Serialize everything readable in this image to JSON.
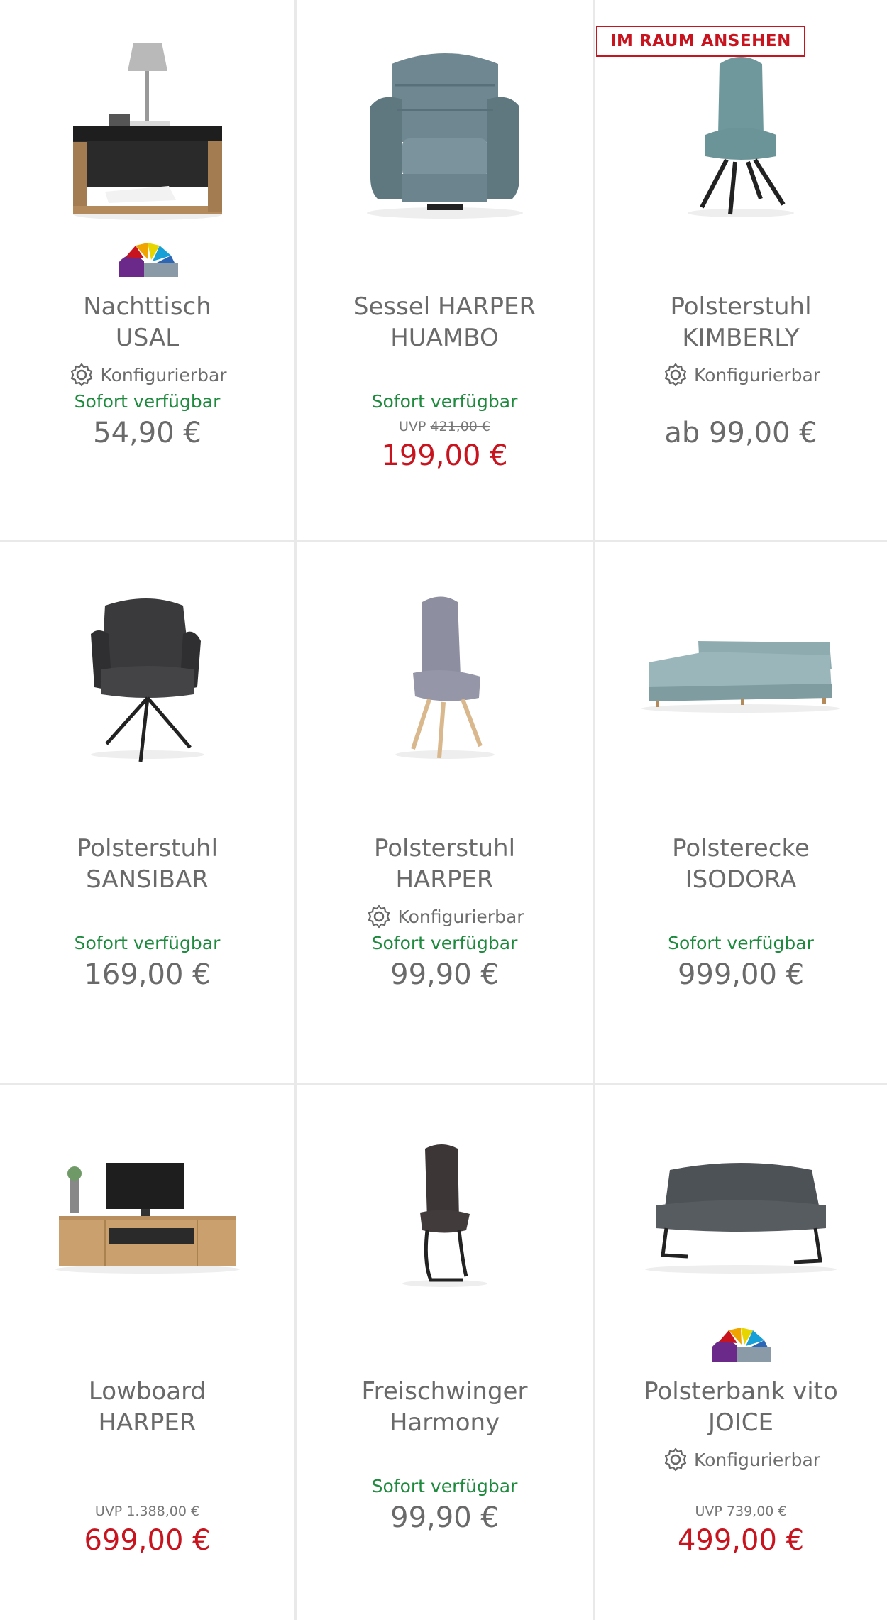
{
  "badge_label": "IM RAUM ANSEHEN",
  "config_label": "Konfigurierbar",
  "available_label": "Sofort verfügbar",
  "uvp_label": "UVP",
  "colors": {
    "available": "#1d8a3d",
    "sale": "#c8141e",
    "text": "#6a6a6a"
  },
  "products": [
    {
      "title_line1": "Nachttisch",
      "title_line2": "USAL",
      "configurable": true,
      "available": true,
      "uvp": "",
      "price": "54,90 €",
      "energy_icon": true,
      "image_icon": "nightstand-image"
    },
    {
      "title_line1": "Sessel HARPER",
      "title_line2": "HUAMBO",
      "configurable": false,
      "available": true,
      "uvp": "421,00 €",
      "price": "199,00 €",
      "energy_icon": false,
      "image_icon": "recliner-image"
    },
    {
      "title_line1": "Polsterstuhl",
      "title_line2": "KIMBERLY",
      "configurable": true,
      "available": false,
      "uvp": "",
      "price": "ab 99,00 €",
      "energy_icon": false,
      "image_icon": "chair-image",
      "badge": true
    },
    {
      "title_line1": "Polsterstuhl",
      "title_line2": "SANSIBAR",
      "configurable": false,
      "available": true,
      "uvp": "",
      "price": "169,00 €",
      "energy_icon": false,
      "image_icon": "armchair-swivel-image"
    },
    {
      "title_line1": "Polsterstuhl",
      "title_line2": "HARPER",
      "configurable": true,
      "available": true,
      "uvp": "",
      "price": "99,90 €",
      "energy_icon": false,
      "image_icon": "grey-chair-image"
    },
    {
      "title_line1": "Polsterecke",
      "title_line2": "ISODORA",
      "configurable": false,
      "available": true,
      "uvp": "",
      "price": "999,00 €",
      "energy_icon": false,
      "image_icon": "corner-sofa-image"
    },
    {
      "title_line1": "Lowboard",
      "title_line2": "HARPER",
      "configurable": false,
      "available": false,
      "uvp": "1.388,00 €",
      "price": "699,00 €",
      "energy_icon": false,
      "image_icon": "lowboard-image"
    },
    {
      "title_line1": "Freischwinger",
      "title_line2": "Harmony",
      "configurable": false,
      "available": true,
      "uvp": "",
      "price": "99,90 €",
      "energy_icon": false,
      "image_icon": "cantilever-chair-image"
    },
    {
      "title_line1": "Polsterbank vito",
      "title_line2": "JOICE",
      "configurable": true,
      "available": false,
      "uvp": "739,00 €",
      "price": "499,00 €",
      "energy_icon": true,
      "image_icon": "bench-image"
    }
  ]
}
